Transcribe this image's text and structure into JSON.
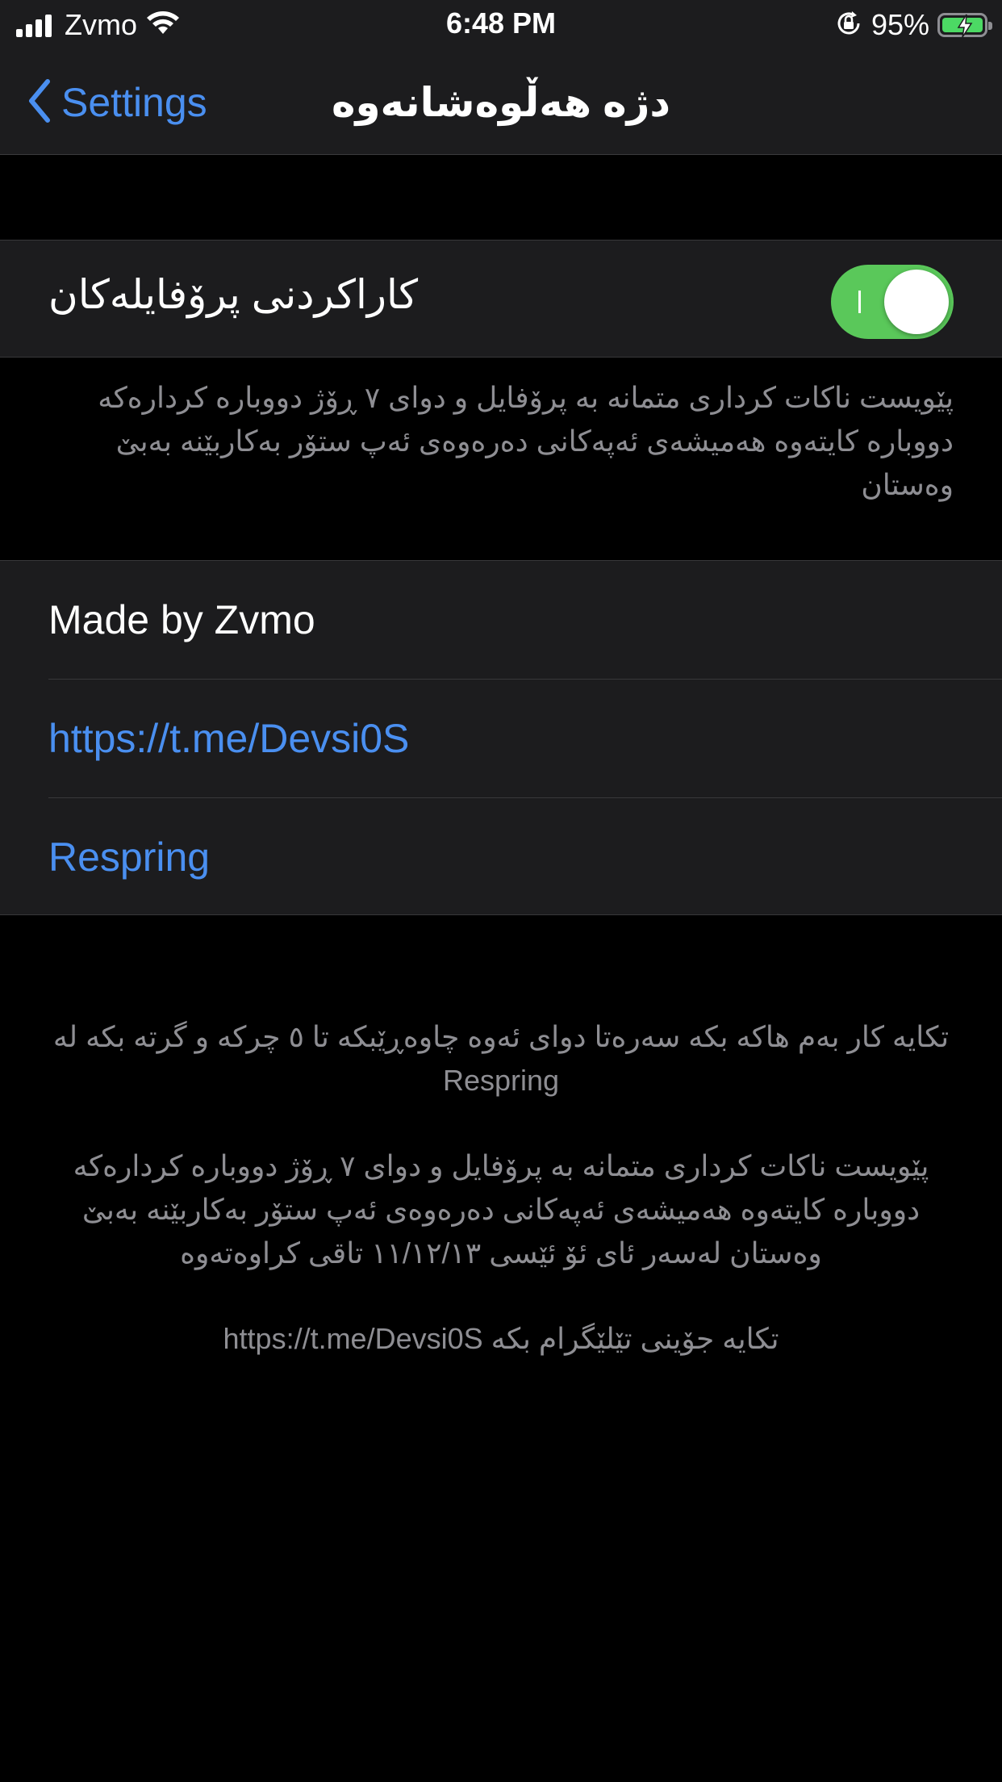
{
  "status_bar": {
    "carrier": "Zvmo",
    "time": "6:48 PM",
    "battery_percent": "95%",
    "signal_bars": 4,
    "icons": [
      "cellular-signal-icon",
      "wifi-icon",
      "orientation-lock-icon",
      "battery-charging-icon"
    ]
  },
  "nav": {
    "back_label": "Settings",
    "title": "دژە هەڵوەشانەوە"
  },
  "toggle": {
    "label": "کاراکردنی پرۆفایلەکان",
    "on": true,
    "on_color": "#5ac85a"
  },
  "toggle_footer": "پێویست ناکات کرداری متمانە بە پرۆفایل و دوای ٧ ڕۆژ دووبارە کردارەکە دووبارە کایتەوە هەمیشەی ئەپەکانی دەرەوەی ئەپ ستۆر بەکاربێنە بەبێ وەستان",
  "links_group": {
    "made_by": "Made by Zvmo",
    "telegram_link": "https://t.me/Devsi0S",
    "respring": "Respring"
  },
  "footer": {
    "line1": "تکایە کار بەم هاکە بکە سەرەتا دوای ئەوە چاوەڕێبکە تا ٥ چرکە و گرتە بکە لە Respring",
    "line2": "پێویست ناکات کرداری متمانە بە پرۆفایل و دوای ٧ ڕۆژ دووبارە کردارەکە دووبارە کایتەوە هەمیشەی ئەپەکانی دەرەوەی ئەپ ستۆر بەکاربێنە بەبێ وەستان لەسەر ئای ئۆ ئێسی ١١/١٢/١٣ تاقی کراوەتەوە",
    "line3": "تکایە جۆینی تێلێگرام بکە   https://t.me/Devsi0S"
  },
  "colors": {
    "accent": "#4a8ff0",
    "background": "#000000",
    "cell_background": "#1c1c1e",
    "secondary_text": "#8e8e93"
  }
}
